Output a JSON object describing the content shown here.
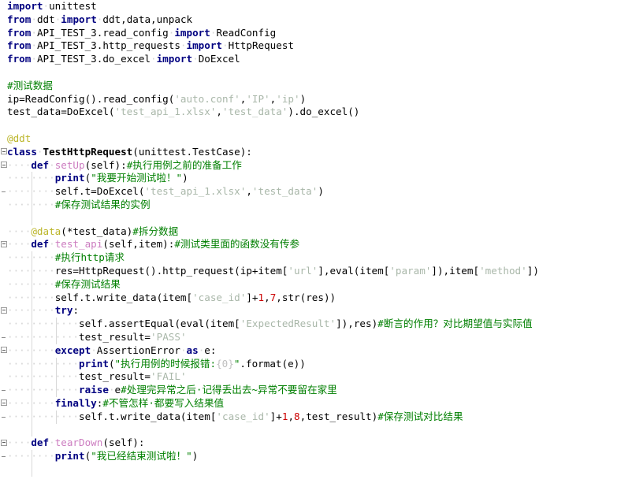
{
  "app": {
    "type": "python-code-editor",
    "language": "Python",
    "theme": "light"
  },
  "colors": {
    "background": "#ffffff",
    "keyword": "#000080",
    "string_literal": "#a9b7a9",
    "string_quoted_green": "#008000",
    "comment": "#007f00",
    "decorator": "#bbb529",
    "function_name": "#cc7dc0",
    "number": "#0000ff",
    "number_red": "#cc0000",
    "plain_text": "#000000",
    "whitespace_dot": "#d4d4d4",
    "indent_guide": "#d8d8d8",
    "fold_marker_border": "#9a9a9a"
  },
  "code": {
    "lines": [
      {
        "n": 1,
        "fold": "none",
        "guides": [],
        "tokens": [
          {
            "t": "import",
            "c": "kw"
          },
          {
            "t": "·",
            "c": "dotws"
          },
          {
            "t": "unittest",
            "c": "plain"
          }
        ]
      },
      {
        "n": 2,
        "fold": "none",
        "guides": [],
        "tokens": [
          {
            "t": "from",
            "c": "kw"
          },
          {
            "t": "·",
            "c": "dotws"
          },
          {
            "t": "ddt",
            "c": "plain"
          },
          {
            "t": "·",
            "c": "dotws"
          },
          {
            "t": "import",
            "c": "kw"
          },
          {
            "t": "·",
            "c": "dotws"
          },
          {
            "t": "ddt,data,unpack",
            "c": "plain"
          }
        ]
      },
      {
        "n": 3,
        "fold": "none",
        "guides": [],
        "tokens": [
          {
            "t": "from",
            "c": "kw"
          },
          {
            "t": "·",
            "c": "dotws"
          },
          {
            "t": "API_TEST_3.read_config",
            "c": "plain"
          },
          {
            "t": "·",
            "c": "dotws"
          },
          {
            "t": "import",
            "c": "kw"
          },
          {
            "t": "·",
            "c": "dotws"
          },
          {
            "t": "ReadConfig",
            "c": "plain"
          }
        ]
      },
      {
        "n": 4,
        "fold": "none",
        "guides": [],
        "tokens": [
          {
            "t": "from",
            "c": "kw"
          },
          {
            "t": "·",
            "c": "dotws"
          },
          {
            "t": "API_TEST_3.http_requests",
            "c": "plain"
          },
          {
            "t": "·",
            "c": "dotws"
          },
          {
            "t": "import",
            "c": "kw"
          },
          {
            "t": "·",
            "c": "dotws"
          },
          {
            "t": "HttpRequest",
            "c": "plain"
          }
        ]
      },
      {
        "n": 5,
        "fold": "none",
        "guides": [],
        "tokens": [
          {
            "t": "from",
            "c": "kw"
          },
          {
            "t": "·",
            "c": "dotws"
          },
          {
            "t": "API_TEST_3.do_excel",
            "c": "plain"
          },
          {
            "t": "·",
            "c": "dotws"
          },
          {
            "t": "import",
            "c": "kw"
          },
          {
            "t": "·",
            "c": "dotws"
          },
          {
            "t": "DoExcel",
            "c": "plain"
          }
        ]
      },
      {
        "n": 6,
        "fold": "none",
        "guides": [],
        "tokens": []
      },
      {
        "n": 7,
        "fold": "none",
        "guides": [],
        "tokens": [
          {
            "t": "#测试数据",
            "c": "cmt"
          }
        ]
      },
      {
        "n": 8,
        "fold": "none",
        "guides": [],
        "tokens": [
          {
            "t": "ip=ReadConfig().read_config(",
            "c": "plain"
          },
          {
            "t": "'auto.conf'",
            "c": "str"
          },
          {
            "t": ",",
            "c": "plain"
          },
          {
            "t": "'IP'",
            "c": "str"
          },
          {
            "t": ",",
            "c": "plain"
          },
          {
            "t": "'ip'",
            "c": "str"
          },
          {
            "t": ")",
            "c": "plain"
          }
        ]
      },
      {
        "n": 9,
        "fold": "none",
        "guides": [],
        "tokens": [
          {
            "t": "test_data=DoExcel(",
            "c": "plain"
          },
          {
            "t": "'test_api_1.xlsx'",
            "c": "str"
          },
          {
            "t": ",",
            "c": "plain"
          },
          {
            "t": "'test_data'",
            "c": "str"
          },
          {
            "t": ").do_excel()",
            "c": "plain"
          }
        ]
      },
      {
        "n": 10,
        "fold": "none",
        "guides": [],
        "tokens": []
      },
      {
        "n": 11,
        "fold": "none",
        "guides": [],
        "tokens": [
          {
            "t": "@ddt",
            "c": "deco"
          }
        ]
      },
      {
        "n": 12,
        "fold": "minus",
        "guides": [],
        "tokens": [
          {
            "t": "class",
            "c": "kw"
          },
          {
            "t": "·",
            "c": "dotws"
          },
          {
            "t": "TestHttpRequest",
            "c": "cls"
          },
          {
            "t": "(unittest.TestCase):",
            "c": "plain"
          }
        ]
      },
      {
        "n": 13,
        "fold": "minus",
        "guides": [],
        "tokens": [
          {
            "t": "····",
            "c": "dotws"
          },
          {
            "t": "def",
            "c": "kw"
          },
          {
            "t": "·",
            "c": "dotws"
          },
          {
            "t": "setUp",
            "c": "func"
          },
          {
            "t": "(self):",
            "c": "plain"
          },
          {
            "t": "#执行用例之前的准备工作",
            "c": "cmt"
          }
        ]
      },
      {
        "n": 14,
        "fold": "none",
        "guides": [
          40
        ],
        "tokens": [
          {
            "t": "····",
            "c": "dotws"
          },
          {
            "t": "····",
            "c": "dotws"
          },
          {
            "t": "print",
            "c": "kw"
          },
          {
            "t": "(",
            "c": "plain"
          },
          {
            "t": "\"我要开始测试啦！\"",
            "c": "strq"
          },
          {
            "t": ")",
            "c": "plain"
          }
        ]
      },
      {
        "n": 15,
        "fold": "dash",
        "guides": [
          40
        ],
        "tokens": [
          {
            "t": "····",
            "c": "dotws"
          },
          {
            "t": "····",
            "c": "dotws"
          },
          {
            "t": "self.t=DoExcel(",
            "c": "plain"
          },
          {
            "t": "'test_api_1.xlsx'",
            "c": "str"
          },
          {
            "t": ",",
            "c": "plain"
          },
          {
            "t": "'test_data'",
            "c": "str"
          },
          {
            "t": ")",
            "c": "plain"
          }
        ]
      },
      {
        "n": 16,
        "fold": "none",
        "guides": [
          40
        ],
        "tokens": [
          {
            "t": "····",
            "c": "dotws"
          },
          {
            "t": "····",
            "c": "dotws"
          },
          {
            "t": "#保存测试结果的实例",
            "c": "cmt"
          }
        ]
      },
      {
        "n": 17,
        "fold": "none",
        "guides": [
          40
        ],
        "tokens": []
      },
      {
        "n": 18,
        "fold": "none",
        "guides": [],
        "tokens": [
          {
            "t": "····",
            "c": "dotws"
          },
          {
            "t": "@data",
            "c": "deco"
          },
          {
            "t": "(*test_data)",
            "c": "plain"
          },
          {
            "t": "#拆分数据",
            "c": "cmt"
          }
        ]
      },
      {
        "n": 19,
        "fold": "minus",
        "guides": [],
        "tokens": [
          {
            "t": "····",
            "c": "dotws"
          },
          {
            "t": "def",
            "c": "kw"
          },
          {
            "t": "·",
            "c": "dotws"
          },
          {
            "t": "test_api",
            "c": "func"
          },
          {
            "t": "(self,item):",
            "c": "plain"
          },
          {
            "t": "#测试类里面的函数没有传参",
            "c": "cmt"
          }
        ]
      },
      {
        "n": 20,
        "fold": "none",
        "guides": [
          40
        ],
        "tokens": [
          {
            "t": "····",
            "c": "dotws"
          },
          {
            "t": "····",
            "c": "dotws"
          },
          {
            "t": "#执行http请求",
            "c": "cmt"
          }
        ]
      },
      {
        "n": 21,
        "fold": "none",
        "guides": [
          40
        ],
        "tokens": [
          {
            "t": "····",
            "c": "dotws"
          },
          {
            "t": "····",
            "c": "dotws"
          },
          {
            "t": "res=HttpRequest().http_request(ip+item[",
            "c": "plain"
          },
          {
            "t": "'url'",
            "c": "str"
          },
          {
            "t": "],eval(item[",
            "c": "plain"
          },
          {
            "t": "'param'",
            "c": "str"
          },
          {
            "t": "]),item[",
            "c": "plain"
          },
          {
            "t": "'method'",
            "c": "str"
          },
          {
            "t": "])",
            "c": "plain"
          }
        ]
      },
      {
        "n": 22,
        "fold": "none",
        "guides": [
          40
        ],
        "tokens": [
          {
            "t": "····",
            "c": "dotws"
          },
          {
            "t": "····",
            "c": "dotws"
          },
          {
            "t": "#保存测试结果",
            "c": "cmt"
          }
        ]
      },
      {
        "n": 23,
        "fold": "none",
        "guides": [
          40
        ],
        "tokens": [
          {
            "t": "····",
            "c": "dotws"
          },
          {
            "t": "····",
            "c": "dotws"
          },
          {
            "t": "self.t.write_data(item[",
            "c": "plain"
          },
          {
            "t": "'case_id'",
            "c": "str"
          },
          {
            "t": "]+",
            "c": "plain"
          },
          {
            "t": "1",
            "c": "numred"
          },
          {
            "t": ",",
            "c": "plain"
          },
          {
            "t": "7",
            "c": "numred"
          },
          {
            "t": ",str(res))",
            "c": "plain"
          }
        ]
      },
      {
        "n": 24,
        "fold": "minus",
        "guides": [
          40
        ],
        "tokens": [
          {
            "t": "····",
            "c": "dotws"
          },
          {
            "t": "····",
            "c": "dotws"
          },
          {
            "t": "try",
            "c": "kw"
          },
          {
            "t": ":",
            "c": "plain"
          }
        ]
      },
      {
        "n": 25,
        "fold": "none",
        "guides": [
          40,
          71
        ],
        "tokens": [
          {
            "t": "····",
            "c": "dotws"
          },
          {
            "t": "····",
            "c": "dotws"
          },
          {
            "t": "····",
            "c": "dotws"
          },
          {
            "t": "self.assertEqual(eval(item[",
            "c": "plain"
          },
          {
            "t": "'ExpectedResult'",
            "c": "str"
          },
          {
            "t": "]),res)",
            "c": "plain"
          },
          {
            "t": "#断言的作用？对比期望值与实际值",
            "c": "cmt"
          }
        ]
      },
      {
        "n": 26,
        "fold": "dash",
        "guides": [
          40,
          71
        ],
        "tokens": [
          {
            "t": "····",
            "c": "dotws"
          },
          {
            "t": "····",
            "c": "dotws"
          },
          {
            "t": "····",
            "c": "dotws"
          },
          {
            "t": "test_result=",
            "c": "plain"
          },
          {
            "t": "'PASS'",
            "c": "str"
          }
        ]
      },
      {
        "n": 27,
        "fold": "minus",
        "guides": [
          40
        ],
        "tokens": [
          {
            "t": "····",
            "c": "dotws"
          },
          {
            "t": "····",
            "c": "dotws"
          },
          {
            "t": "except",
            "c": "kw"
          },
          {
            "t": "·",
            "c": "dotws"
          },
          {
            "t": "AssertionError",
            "c": "plain"
          },
          {
            "t": "·",
            "c": "dotws"
          },
          {
            "t": "as",
            "c": "kw"
          },
          {
            "t": "·",
            "c": "dotws"
          },
          {
            "t": "e:",
            "c": "plain"
          }
        ]
      },
      {
        "n": 28,
        "fold": "none",
        "guides": [
          40,
          71
        ],
        "tokens": [
          {
            "t": "····",
            "c": "dotws"
          },
          {
            "t": "····",
            "c": "dotws"
          },
          {
            "t": "····",
            "c": "dotws"
          },
          {
            "t": "print",
            "c": "kw"
          },
          {
            "t": "(",
            "c": "plain"
          },
          {
            "t": "\"执行用例的时候报错:",
            "c": "strq"
          },
          {
            "t": "{0}",
            "c": "esc"
          },
          {
            "t": "\"",
            "c": "strq"
          },
          {
            "t": ".format(e))",
            "c": "plain"
          }
        ]
      },
      {
        "n": 29,
        "fold": "none",
        "guides": [
          40,
          71
        ],
        "tokens": [
          {
            "t": "····",
            "c": "dotws"
          },
          {
            "t": "····",
            "c": "dotws"
          },
          {
            "t": "····",
            "c": "dotws"
          },
          {
            "t": "test_result=",
            "c": "plain"
          },
          {
            "t": "'FAIL'",
            "c": "str"
          }
        ]
      },
      {
        "n": 30,
        "fold": "dash",
        "guides": [
          40,
          71
        ],
        "tokens": [
          {
            "t": "····",
            "c": "dotws"
          },
          {
            "t": "····",
            "c": "dotws"
          },
          {
            "t": "····",
            "c": "dotws"
          },
          {
            "t": "raise",
            "c": "kw"
          },
          {
            "t": "·",
            "c": "dotws"
          },
          {
            "t": "e",
            "c": "plain"
          },
          {
            "t": "#处理完异常之后·记得丢出去~异常不要留在家里",
            "c": "cmt"
          }
        ]
      },
      {
        "n": 31,
        "fold": "minus",
        "guides": [
          40
        ],
        "tokens": [
          {
            "t": "····",
            "c": "dotws"
          },
          {
            "t": "····",
            "c": "dotws"
          },
          {
            "t": "finally",
            "c": "kw"
          },
          {
            "t": ":",
            "c": "plain"
          },
          {
            "t": "#不管怎样·都要写入结果值",
            "c": "cmt"
          }
        ]
      },
      {
        "n": 32,
        "fold": "dash",
        "guides": [
          40,
          71
        ],
        "tokens": [
          {
            "t": "····",
            "c": "dotws"
          },
          {
            "t": "····",
            "c": "dotws"
          },
          {
            "t": "····",
            "c": "dotws"
          },
          {
            "t": "self.t.write_data(item[",
            "c": "plain"
          },
          {
            "t": "'case_id'",
            "c": "str"
          },
          {
            "t": "]+",
            "c": "plain"
          },
          {
            "t": "1",
            "c": "numred"
          },
          {
            "t": ",",
            "c": "plain"
          },
          {
            "t": "8",
            "c": "numred"
          },
          {
            "t": ",test_result)",
            "c": "plain"
          },
          {
            "t": "#保存测试对比结果",
            "c": "cmt"
          }
        ]
      },
      {
        "n": 33,
        "fold": "none",
        "guides": [
          40
        ],
        "tokens": []
      },
      {
        "n": 34,
        "fold": "minus",
        "guides": [],
        "tokens": [
          {
            "t": "····",
            "c": "dotws"
          },
          {
            "t": "def",
            "c": "kw"
          },
          {
            "t": "·",
            "c": "dotws"
          },
          {
            "t": "tearDown",
            "c": "func"
          },
          {
            "t": "(self):",
            "c": "plain"
          }
        ]
      },
      {
        "n": 35,
        "fold": "dash",
        "guides": [
          40
        ],
        "tokens": [
          {
            "t": "····",
            "c": "dotws"
          },
          {
            "t": "····",
            "c": "dotws"
          },
          {
            "t": "print",
            "c": "kw"
          },
          {
            "t": "(",
            "c": "plain"
          },
          {
            "t": "\"我已经结束测试啦！\"",
            "c": "strq"
          },
          {
            "t": ")",
            "c": "plain"
          }
        ]
      },
      {
        "n": 36,
        "fold": "none",
        "guides": [
          40
        ],
        "tokens": []
      }
    ]
  }
}
